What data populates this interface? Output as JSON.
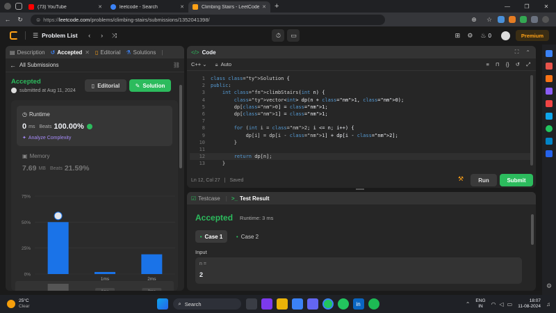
{
  "browser": {
    "tabs": [
      {
        "title": "(73) YouTube",
        "favicon_color": "#ff0000"
      },
      {
        "title": "leetcode - Search",
        "favicon_color": "#3b82f6"
      },
      {
        "title": "Climbing Stairs - LeetCode",
        "favicon_color": "#ffa116"
      }
    ],
    "url_prefix": "https://",
    "url_domain": "leetcode.com",
    "url_path": "/problems/climbing-stairs/submissions/1352041398/"
  },
  "nav": {
    "problem_list": "Problem List",
    "streak": "0",
    "premium": "Premium"
  },
  "left_panel": {
    "tabs": [
      "Description",
      "Accepted",
      "Editorial",
      "Solutions"
    ],
    "all_submissions": "All Submissions",
    "status": "Accepted",
    "submitted": "submitted at Aug 11, 2024",
    "editorial_btn": "Editorial",
    "solution_btn": "Solution",
    "runtime_label": "Runtime",
    "runtime_value": "0",
    "runtime_unit": "ms",
    "runtime_beats_label": "Beats",
    "runtime_beats": "100.00%",
    "analyze": "Analyze Complexity",
    "memory_label": "Memory",
    "memory_value": "7.69",
    "memory_unit": "MB",
    "memory_beats_label": "Beats",
    "memory_beats": "21.59%"
  },
  "chart_data": {
    "type": "bar",
    "y_ticks": [
      "75%",
      "50%",
      "25%",
      "0%"
    ],
    "ylim": [
      0,
      75
    ],
    "categories": [
      "0ms",
      "1ms",
      "2ms"
    ],
    "x_labels": [
      "",
      "1ms",
      "2ms"
    ],
    "values": [
      50,
      2,
      19
    ],
    "highlight_index": 0,
    "mini_labels": [
      "1ms",
      "2ms"
    ]
  },
  "code_panel": {
    "title": "Code",
    "language": "C++",
    "mode": "Auto",
    "lines": [
      "class Solution {",
      "public:",
      "    int climbStairs(int n) {",
      "        vector<int> dp(n + 1, 0);",
      "        dp[0] = 1;",
      "        dp[1] = 1;",
      "",
      "        for (int i = 2; i <= n; i++) {",
      "            dp[i] = dp[i - 1] + dp[i - 2];",
      "        }",
      "",
      "        return dp[n];",
      "    }"
    ],
    "status": "Ln 12, Col 27",
    "saved": "Saved",
    "run": "Run",
    "submit": "Submit"
  },
  "result_panel": {
    "tab_testcase": "Testcase",
    "tab_result": "Test Result",
    "status": "Accepted",
    "runtime": "Runtime: 3 ms",
    "cases": [
      "Case 1",
      "Case 2"
    ],
    "input_label": "Input",
    "var_name": "n =",
    "var_value": "2"
  },
  "taskbar": {
    "temp": "25°C",
    "weather": "Clear",
    "search": "Search",
    "lang1": "ENG",
    "lang2": "IN",
    "time": "18:07",
    "date": "11-08-2024"
  }
}
